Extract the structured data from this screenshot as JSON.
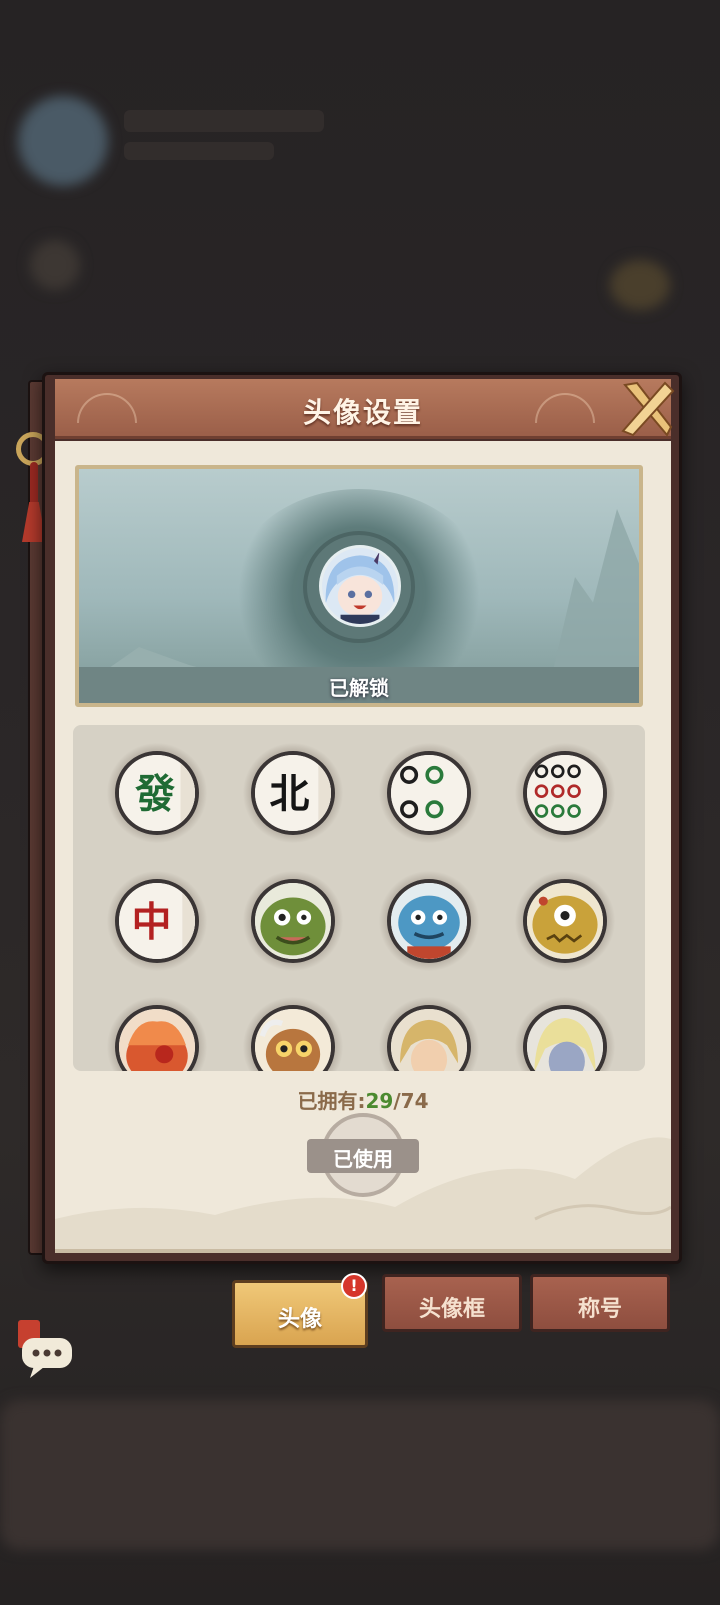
{
  "modal": {
    "title": "头像设置",
    "preview_status": "已解锁",
    "owned_label": "已拥有:",
    "owned_count": "29",
    "owned_total": "/74",
    "use_button_label": "已使用"
  },
  "tabs": [
    {
      "label": "头像",
      "active": true,
      "badge": "!"
    },
    {
      "label": "头像框",
      "active": false
    },
    {
      "label": "称号",
      "active": false
    }
  ],
  "avatars": {
    "tile_glyphs": [
      "發",
      "北",
      "中"
    ]
  },
  "colors": {
    "accent_green": "#4b8a2f",
    "header_brown": "#9b5f49",
    "paper": "#efe8da",
    "tab_active": "#d9a450",
    "badge_red": "#d6362b"
  }
}
